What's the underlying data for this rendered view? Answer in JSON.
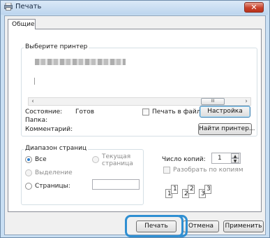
{
  "window": {
    "title": "Печать",
    "close_label": "✕",
    "tab_general": "Общие"
  },
  "printer_group": {
    "legend": "Выберите принтер",
    "selected_printer_obscured": true,
    "status_label": "Состояние:",
    "status_value": "Готов",
    "folder_label": "Папка:",
    "comment_label": "Комментарий:",
    "print_to_file_label": "Печать в файл",
    "print_to_file_checked": false,
    "settings_button": "Настройка",
    "find_printer_button": "Найти принтер...",
    "scroll_left": "‹",
    "scroll_right": "›",
    "scroll_thumb": "III"
  },
  "range_group": {
    "legend": "Диапазон страниц",
    "all_label": "Все",
    "all_selected": true,
    "current_page_label_1": "Текущая",
    "current_page_label_2": "страница",
    "selection_label": "Выделение",
    "pages_label": "Страницы:",
    "pages_value": ""
  },
  "copies_group": {
    "copies_label": "Число копий:",
    "copies_value": "1",
    "collate_label": "Разобрать по копиям",
    "collate_checked": false,
    "collate_pages": [
      "1",
      "1",
      "2",
      "2",
      "3",
      "3"
    ]
  },
  "buttons": {
    "print": "Печать",
    "cancel": "Отмена",
    "apply": "Применить"
  },
  "highlight_color": "#2f8fd2"
}
